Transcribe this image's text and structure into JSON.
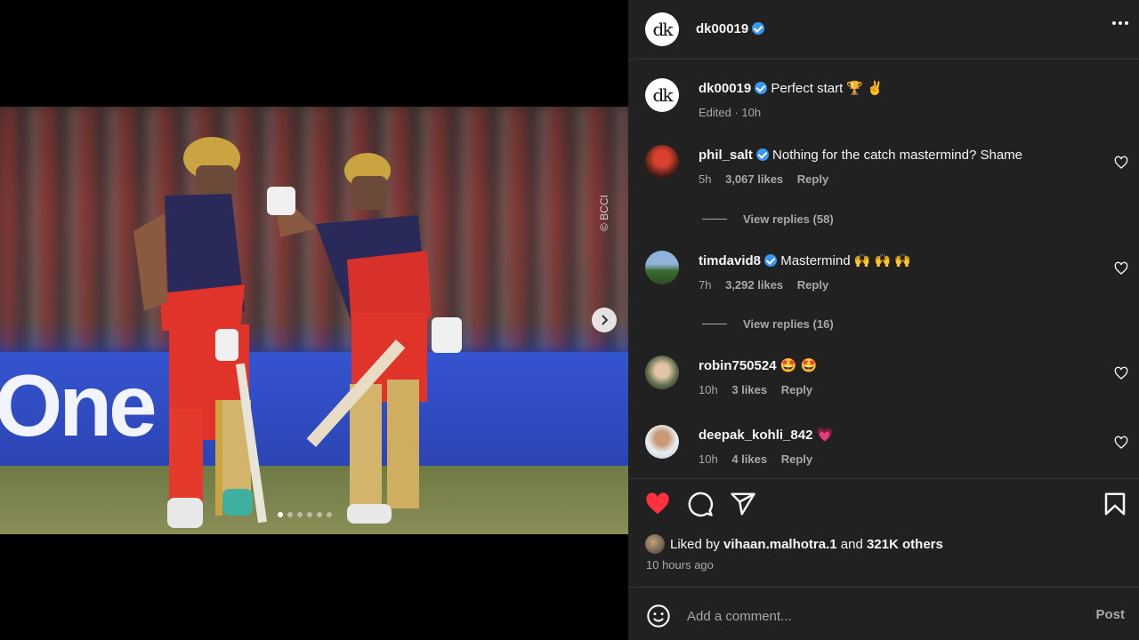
{
  "media": {
    "watermark": "© BCCI",
    "board_text": "One",
    "carousel_count": 6,
    "carousel_active": 0
  },
  "header": {
    "username": "dk00019",
    "avatar_text": "dk"
  },
  "caption": {
    "username": "dk00019",
    "text": "Perfect start 🏆 ✌",
    "meta": "Edited · 10h"
  },
  "comments": [
    {
      "username": "phil_salt",
      "verified": true,
      "text": "Nothing for the catch mastermind? Shame",
      "time": "5h",
      "likes": "3,067 likes",
      "reply": "Reply",
      "view_replies": "View replies (58)"
    },
    {
      "username": "timdavid8",
      "verified": true,
      "text": "Mastermind 🙌 🙌 🙌",
      "time": "7h",
      "likes": "3,292 likes",
      "reply": "Reply",
      "view_replies": "View replies (16)"
    },
    {
      "username": "robin750524",
      "verified": false,
      "text": "🤩 🤩",
      "time": "10h",
      "likes": "3 likes",
      "reply": "Reply"
    },
    {
      "username": "deepak_kohli_842",
      "verified": false,
      "text": "💗",
      "time": "10h",
      "likes": "4 likes",
      "reply": "Reply"
    }
  ],
  "likes": {
    "prefix": "Liked by",
    "user": "vihaan.malhotra.1",
    "and": "and",
    "others": "321K others",
    "time_ago": "10 hours ago"
  },
  "composer": {
    "placeholder": "Add a comment...",
    "post_label": "Post"
  },
  "icons": {
    "like": "heart-filled-icon",
    "comment": "comment-icon",
    "share": "share-icon",
    "save": "bookmark-icon",
    "more": "more-icon",
    "emoji": "emoji-icon",
    "next": "chevron-right-icon"
  },
  "colors": {
    "panel_bg": "#212121",
    "like_red": "#ff3040",
    "verified_blue": "#3897f0",
    "muted_text": "#a8a8a8"
  }
}
